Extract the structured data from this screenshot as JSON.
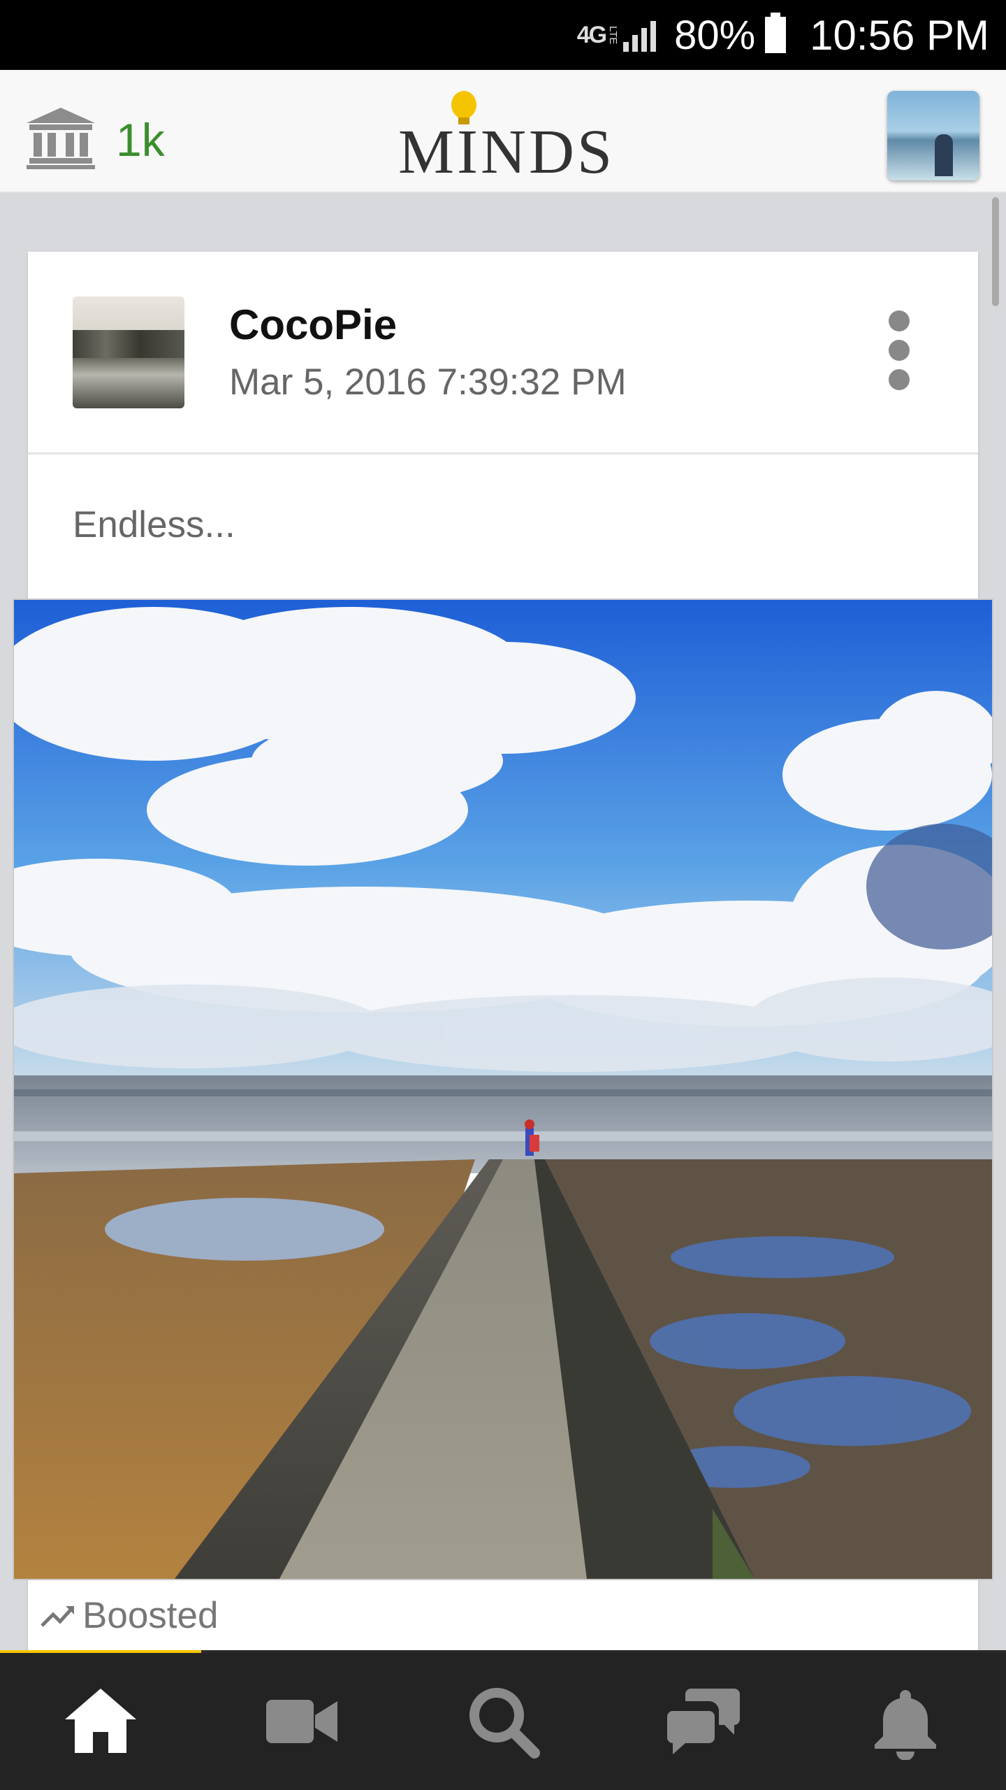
{
  "status_bar": {
    "network": "4G",
    "network_sub": "LTE",
    "battery": "80%",
    "time": "10:56 PM"
  },
  "header": {
    "points": "1k",
    "logo_text": "MINDS"
  },
  "post": {
    "username": "CocoPie",
    "timestamp": "Mar 5, 2016 7:39:32 PM",
    "message": "Endless...",
    "boosted_label": "Boosted"
  },
  "progress": {
    "value": 0.2
  },
  "nav": {
    "items": [
      "home-icon",
      "video-icon",
      "search-icon",
      "chat-icon",
      "bell-icon"
    ],
    "active": "home-icon"
  },
  "colors": {
    "points_green": "#3a8e2d",
    "accent_yellow": "#f5c400",
    "nav_bg": "#232323"
  }
}
